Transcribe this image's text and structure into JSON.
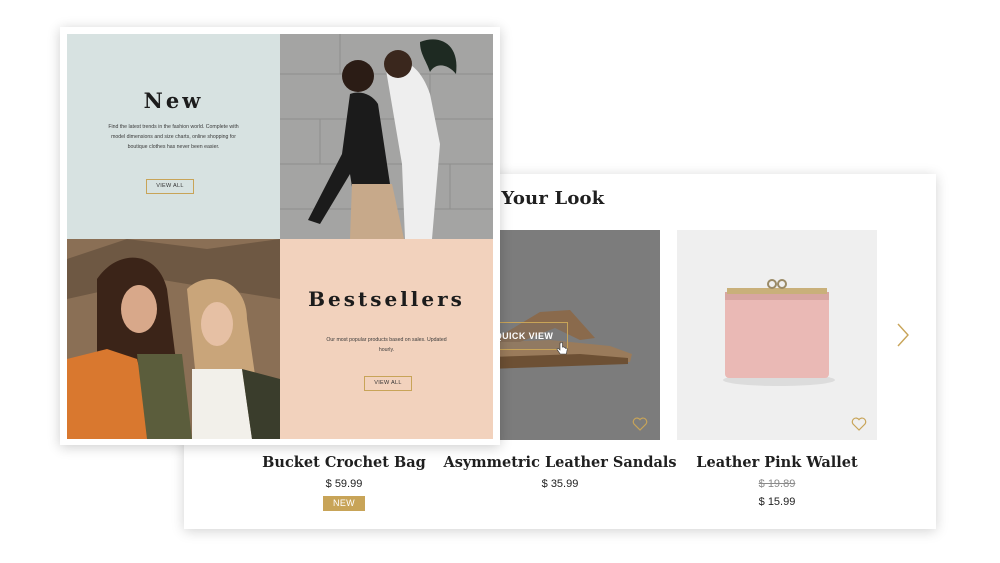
{
  "look": {
    "title": "mplete Your Look",
    "products": [
      {
        "name": "Bucket Crochet Bag",
        "price": "$ 59.99",
        "badge": "NEW"
      },
      {
        "name": "Asymmetric Leather Sandals",
        "price": "$ 35.99",
        "quick_view": "QUICK VIEW"
      },
      {
        "name": "Leather Pink Wallet",
        "old_price": "$ 19.89",
        "price": "$ 15.99"
      }
    ]
  },
  "grid": {
    "new": {
      "heading": "New",
      "text": "Find the latest trends in the fashion world. Complete with model dimensions and size charts, online shopping for boutique clothes has never been easier.",
      "button": "VIEW ALL"
    },
    "bestsellers": {
      "heading": "Bestsellers",
      "text": "Our most popular products based on sales. Updated hourly.",
      "button": "VIEW ALL"
    }
  },
  "icons": [
    "heart-icon",
    "chevron-right-icon",
    "cursor-hand-icon"
  ],
  "colors": {
    "accent": "#c8a458",
    "new_bg": "#d7e2e1",
    "bestsellers_bg": "#f2d2bd"
  }
}
